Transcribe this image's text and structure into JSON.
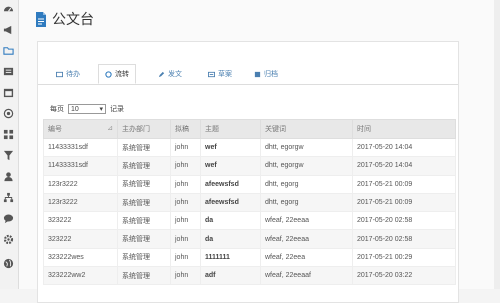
{
  "page": {
    "title": "公文台"
  },
  "sidebar": {
    "icons": [
      "dashboard-icon",
      "megaphone-icon",
      "folder-icon",
      "list-icon",
      "calendar-icon",
      "target-icon",
      "grid-icon",
      "filter-icon",
      "user-icon",
      "org-chart-icon",
      "chat-icon",
      "gear-icon",
      "globe-icon"
    ]
  },
  "tabs": [
    {
      "label": "待办",
      "active": false
    },
    {
      "label": "流转",
      "active": true
    },
    {
      "label": "发文",
      "active": false
    },
    {
      "label": "草案",
      "active": false
    },
    {
      "label": "归档",
      "active": false
    }
  ],
  "perpage": {
    "prefix": "每页",
    "value": "10",
    "suffix": "记录"
  },
  "table": {
    "headers": [
      "编号",
      "主办部门",
      "拟稿",
      "主题",
      "关键词",
      "时间"
    ],
    "rows": [
      [
        "11433331sdf",
        "系统管理",
        "john",
        "wef",
        "dhtt, egorgw",
        "2017-05-20 14:04"
      ],
      [
        "11433331sdf",
        "系统管理",
        "john",
        "wef",
        "dhtt, egorgw",
        "2017-05-20 14:04"
      ],
      [
        "123r3222",
        "系统管理",
        "john",
        "afeewsfsd",
        "dhtt, egorg",
        "2017-05-21 00:09"
      ],
      [
        "123r3222",
        "系统管理",
        "john",
        "afeewsfsd",
        "dhtt, egorg",
        "2017-05-21 00:09"
      ],
      [
        "323222",
        "系统管理",
        "john",
        "da",
        "wfeaf, 22eeaa",
        "2017-05-20 02:58"
      ],
      [
        "323222",
        "系统管理",
        "john",
        "da",
        "wfeaf, 22eeaa",
        "2017-05-20 02:58"
      ],
      [
        "323222wes",
        "系统管理",
        "john",
        "1111111",
        "wfeaf, 22eea",
        "2017-05-21 00:29"
      ],
      [
        "323222ww2",
        "系统管理",
        "john",
        "adf",
        "wfeaf, 22eeaaf",
        "2017-05-20 03:22"
      ]
    ]
  },
  "colors": {
    "accent": "#2f7bbf",
    "header_bg": "#e8e8e8"
  }
}
